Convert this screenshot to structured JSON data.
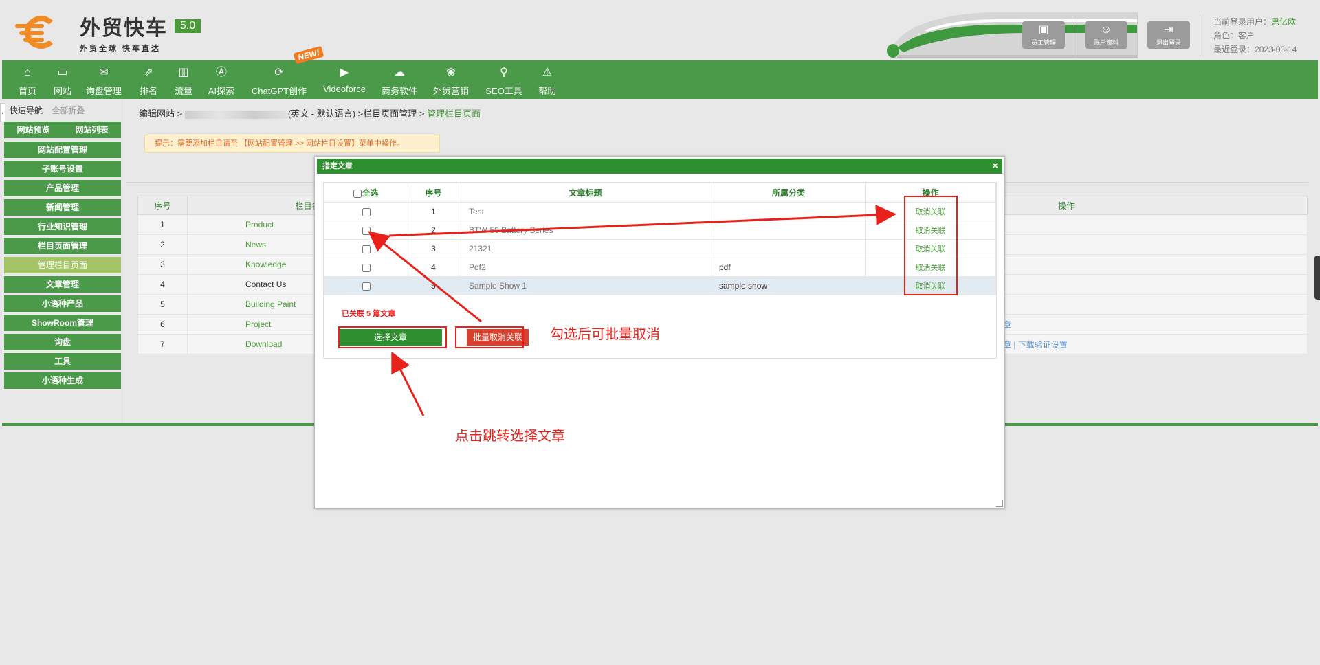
{
  "header": {
    "logo_title": "外贸快车",
    "logo_version": "5.0",
    "logo_slogan": "外贸全球 快车直达",
    "buttons": [
      {
        "label": "员工管理",
        "icon": "staff-icon"
      },
      {
        "label": "账户资料",
        "icon": "account-icon"
      },
      {
        "label": "退出登录",
        "icon": "logout-icon"
      }
    ],
    "user": {
      "current_label": "当前登录用户：",
      "current_value": "思亿欧",
      "role_label": "角色：",
      "role_value": "客户",
      "last_login_label": "最近登录：",
      "last_login_value": "2023-03-14"
    }
  },
  "nav": {
    "new_badge": "NEW!",
    "items": [
      {
        "label": "首页",
        "icon": "⌂"
      },
      {
        "label": "网站",
        "icon": "▭"
      },
      {
        "label": "询盘管理",
        "icon": "✉"
      },
      {
        "label": "排名",
        "icon": "⇗"
      },
      {
        "label": "流量",
        "icon": "▥"
      },
      {
        "label": "AI探索",
        "icon": "Ⓐ"
      },
      {
        "label": "ChatGPT创作",
        "icon": "⟳"
      },
      {
        "label": "Videoforce",
        "icon": "▶"
      },
      {
        "label": "商务软件",
        "icon": "☁"
      },
      {
        "label": "外贸营销",
        "icon": "❀"
      },
      {
        "label": "SEO工具",
        "icon": "⚲"
      },
      {
        "label": "帮助",
        "icon": "⚠"
      }
    ]
  },
  "sidebar": {
    "quick_nav": "快速导航",
    "collapse_all": "全部折叠",
    "preview": "网站预览",
    "site_list": "网站列表",
    "items": [
      "网站配置管理",
      "子账号设置",
      "产品管理",
      "新闻管理",
      "行业知识管理",
      "栏目页面管理",
      "管理栏目页面",
      "文章管理",
      "小语种产品",
      "ShowRoom管理",
      "询盘",
      "工具",
      "小语种生成"
    ]
  },
  "breadcrumb": {
    "prefix": "编辑网站 > ",
    "lang": "(英文 - 默认语言)",
    "section": " >栏目页面管理 > ",
    "current": "管理栏目页面"
  },
  "tip": "提示：需要添加栏目请至 【网站配置管理 >> 网站栏目设置】菜单中操作。",
  "bg_table": {
    "headers": [
      "序号",
      "栏目名称",
      "操作"
    ],
    "rows": [
      {
        "no": "1",
        "name": "Product",
        "op": ""
      },
      {
        "no": "2",
        "name": "News",
        "op": ""
      },
      {
        "no": "3",
        "name": "Knowledge",
        "op": ""
      },
      {
        "no": "4",
        "name": "Contact Us",
        "op": ""
      },
      {
        "no": "5",
        "name": "Building Paint",
        "op": ""
      },
      {
        "no": "6",
        "name": "Project",
        "op": "章"
      },
      {
        "no": "7",
        "name": "Download",
        "op": "章  |  下载验证设置"
      }
    ]
  },
  "modal": {
    "title": "指定文章",
    "close": "×",
    "headers": {
      "select_all": "全选",
      "no": "序号",
      "title": "文章标题",
      "category": "所属分类",
      "action": "操作"
    },
    "rows": [
      {
        "no": "1",
        "title": "Test",
        "category": "",
        "action": "取消关联"
      },
      {
        "no": "2",
        "title": "BTW-50 Battery Series",
        "category": "",
        "action": "取消关联"
      },
      {
        "no": "3",
        "title": "21321",
        "category": "",
        "action": "取消关联"
      },
      {
        "no": "4",
        "title": "Pdf2",
        "category": "pdf",
        "action": "取消关联"
      },
      {
        "no": "5",
        "title": "Sample Show 1",
        "category": "sample show",
        "action": "取消关联"
      }
    ],
    "linked_text": "已关联 5 篇文章",
    "select_button": "选择文章",
    "batch_button": "批量取消关联"
  },
  "annotations": {
    "batch_note": "勾选后可批量取消",
    "select_note": "点击跳转选择文章",
    "color": "#e8221b"
  }
}
